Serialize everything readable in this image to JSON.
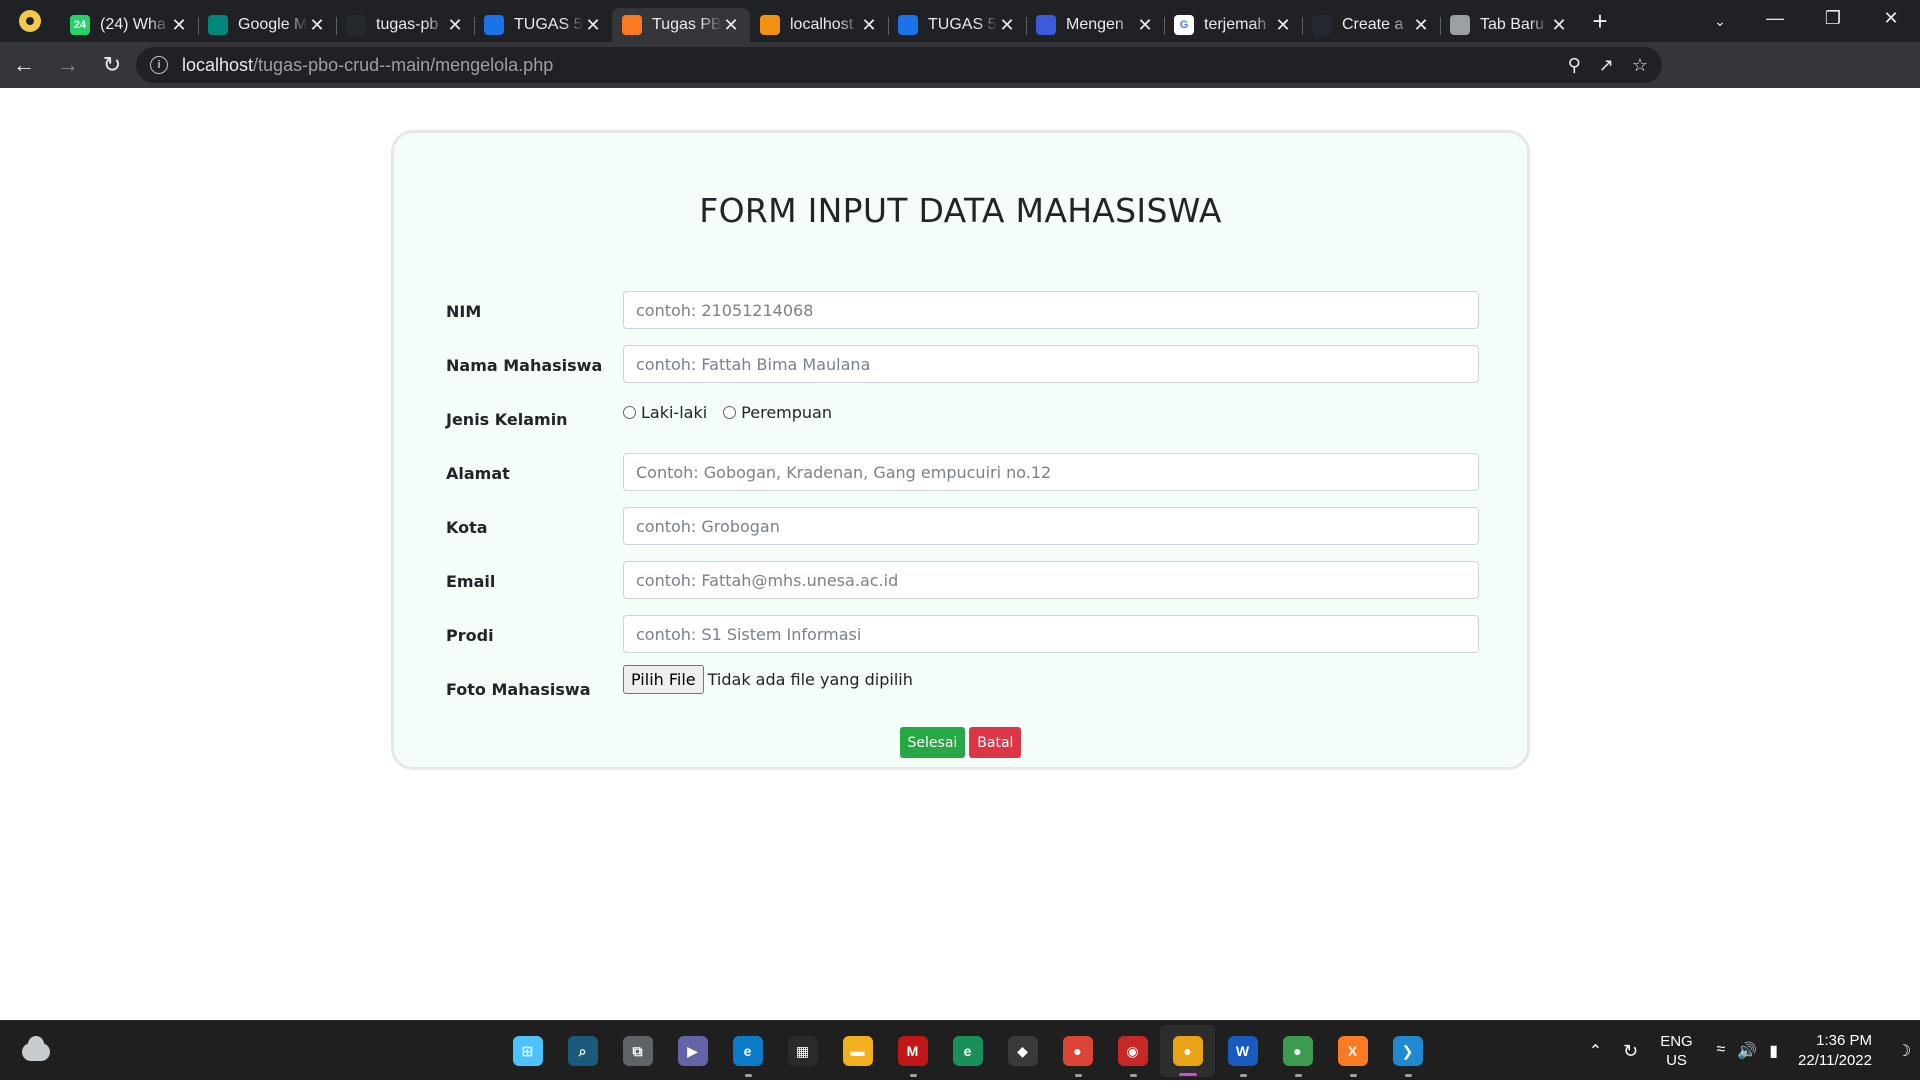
{
  "browser": {
    "tabs": [
      {
        "label": "(24) Wha",
        "favicon": "whatsapp-icon",
        "favicon_text": "24",
        "color": "#25d366"
      },
      {
        "label": "Google M",
        "favicon": "google-meet-icon",
        "favicon_text": "",
        "color": "#00897b"
      },
      {
        "label": "tugas-pb",
        "favicon": "github-icon",
        "favicon_text": "",
        "color": "#24292f"
      },
      {
        "label": "TUGAS 5",
        "favicon": "google-classroom-icon",
        "favicon_text": "",
        "color": "#1a73e8"
      },
      {
        "label": "Tugas PB",
        "favicon": "xampp-icon",
        "favicon_text": "",
        "color": "#fb7a24",
        "active": true
      },
      {
        "label": "localhost",
        "favicon": "phpmyadmin-icon",
        "favicon_text": "",
        "color": "#f29111"
      },
      {
        "label": "TUGAS 5",
        "favicon": "google-classroom-icon",
        "favicon_text": "",
        "color": "#1a73e8"
      },
      {
        "label": "Mengen",
        "favicon": "react-icon",
        "favicon_text": "",
        "color": "#3b5bdb"
      },
      {
        "label": "terjemah",
        "favicon": "google-icon",
        "favicon_text": "G",
        "color": "#ffffff"
      },
      {
        "label": "Create a",
        "favicon": "github-icon",
        "favicon_text": "",
        "color": "#24292f"
      },
      {
        "label": "Tab Baru",
        "favicon": "chrome-icon",
        "favicon_text": "",
        "color": "#9aa0a6"
      }
    ],
    "url_host": "localhost",
    "url_path": "/tugas-pbo-crud--main/mengelola.php"
  },
  "form": {
    "title": "FORM INPUT DATA MAHASISWA",
    "fields": {
      "nim": {
        "label": "NIM",
        "placeholder": "contoh: 21051214068"
      },
      "nama": {
        "label": "Nama Mahasiswa",
        "placeholder": "contoh: Fattah Bima Maulana"
      },
      "jenis_kelamin": {
        "label": "Jenis Kelamin",
        "options": [
          "Laki-laki",
          "Perempuan"
        ]
      },
      "alamat": {
        "label": "Alamat",
        "placeholder": "Contoh: Gobogan, Kradenan, Gang empucuiri no.12"
      },
      "kota": {
        "label": "Kota",
        "placeholder": "contoh: Grobogan"
      },
      "email": {
        "label": "Email",
        "placeholder": "contoh: Fattah@mhs.unesa.ac.id"
      },
      "prodi": {
        "label": "Prodi",
        "placeholder": "contoh: S1 Sistem Informasi"
      },
      "foto": {
        "label": "Foto Mahasiswa",
        "button": "Pilih File",
        "status": "Tidak ada file yang dipilih"
      }
    },
    "submit_label": "Selesai",
    "cancel_label": "Batal",
    "colors": {
      "card_bg": "#f4fdf8",
      "success": "#28a745",
      "danger": "#dc3545"
    }
  },
  "taskbar": {
    "apps": [
      "start-icon",
      "search-icon",
      "task-view-icon",
      "teams-chat-icon",
      "edge-icon",
      "microsoft-store-icon",
      "file-explorer-icon",
      "mcafee-icon",
      "edge-dev-icon",
      "git-icon",
      "chrome-icon",
      "camera-recorder-icon",
      "chrome-canary-icon",
      "word-icon",
      "chrome-dev-icon",
      "xampp-icon",
      "vscode-icon"
    ],
    "lang_line1": "ENG",
    "lang_line2": "US",
    "time": "1:36 PM",
    "date": "22/11/2022"
  }
}
